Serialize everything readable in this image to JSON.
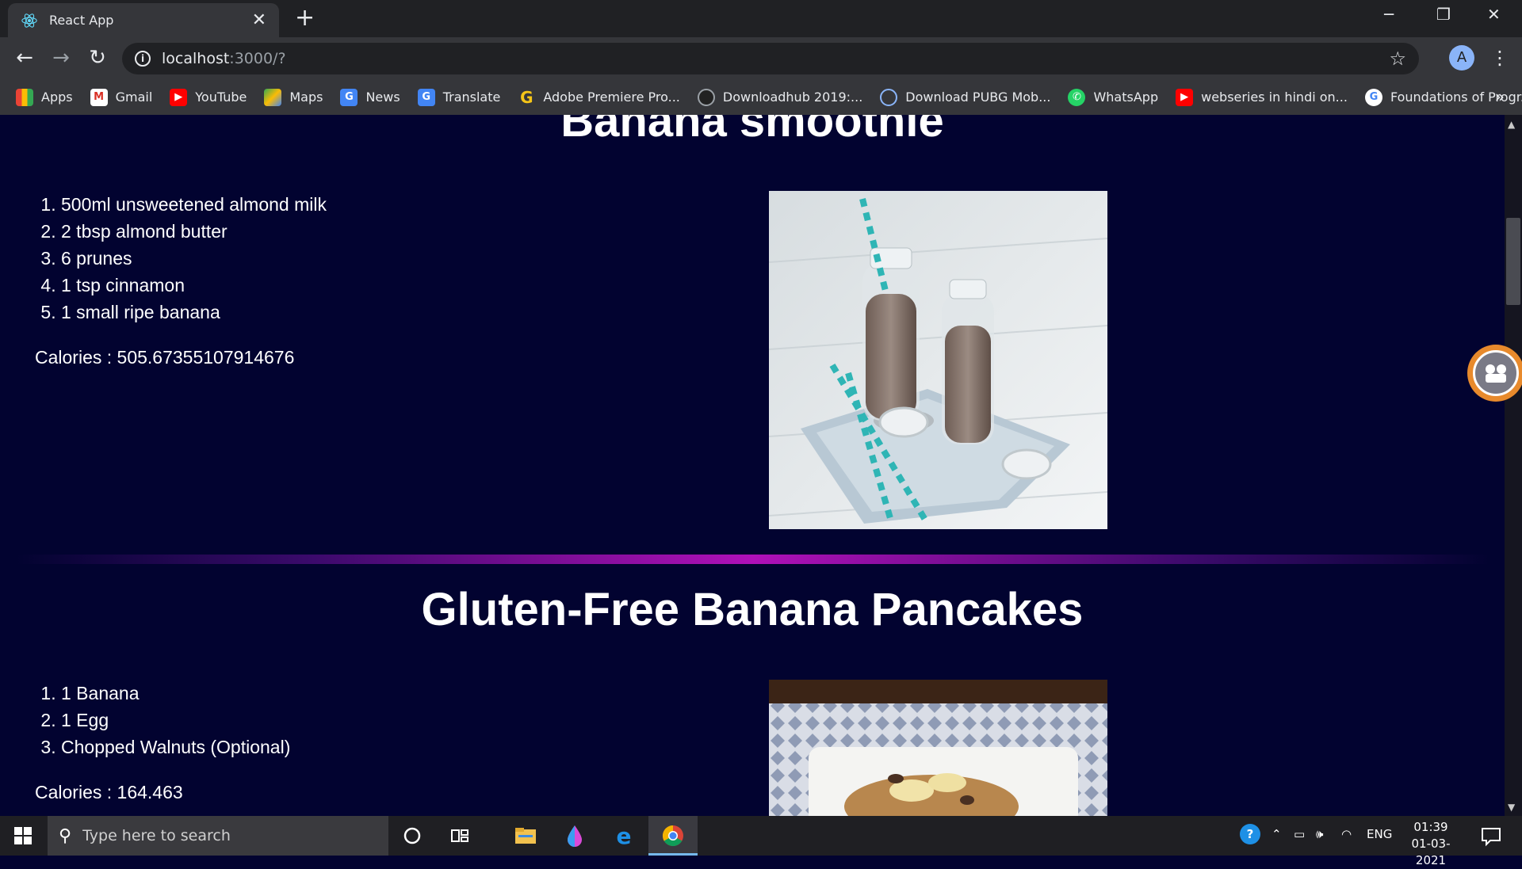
{
  "browser": {
    "tab_title": "React App",
    "tab_close": "✕",
    "new_tab": "+",
    "minimize": "─",
    "restore": "❐",
    "close": "✕",
    "back": "←",
    "forward": "→",
    "reload": "↻",
    "url_host": "localhost",
    "url_path": ":3000/?",
    "star": "☆",
    "avatar_letter": "A",
    "menu": "⋮",
    "bookmarks_more": "»",
    "bookmarks": [
      {
        "label": "Apps",
        "icon": "apps-grid-icon"
      },
      {
        "label": "Gmail",
        "icon": "gmail-icon"
      },
      {
        "label": "YouTube",
        "icon": "youtube-icon"
      },
      {
        "label": "Maps",
        "icon": "maps-icon"
      },
      {
        "label": "News",
        "icon": "news-icon"
      },
      {
        "label": "Translate",
        "icon": "translate-icon"
      },
      {
        "label": "Adobe Premiere Pro...",
        "icon": "g-letter-icon"
      },
      {
        "label": "Downloadhub 2019:...",
        "icon": "downloadhub-icon"
      },
      {
        "label": "Download PUBG Mob...",
        "icon": "pubg-icon"
      },
      {
        "label": "WhatsApp",
        "icon": "whatsapp-icon"
      },
      {
        "label": "webseries in hindi on...",
        "icon": "youtube-icon"
      },
      {
        "label": "Foundations of Progr...",
        "icon": "google-icon"
      }
    ]
  },
  "recipes": [
    {
      "title": "Banana smoothie",
      "ingredients": [
        "500ml unsweetened almond milk",
        "2 tbsp almond butter",
        "6 prunes",
        "1 tsp cinnamon",
        "1 small ripe banana"
      ],
      "calories_text": "Calories : 505.67355107914676"
    },
    {
      "title": "Gluten-Free Banana Pancakes",
      "ingredients": [
        "1 Banana",
        "1 Egg",
        "Chopped Walnuts (Optional)"
      ],
      "calories_text": "Calories : 164.463"
    }
  ],
  "taskbar": {
    "search_placeholder": "Type here to search",
    "tray_lang": "ENG",
    "time": "01:39",
    "date": "01-03-2021"
  },
  "colors": {
    "page_bg": "#020330",
    "divider_accent": "#b010b8",
    "chrome_dark": "#202124",
    "chrome_toolbar": "#35363a"
  }
}
